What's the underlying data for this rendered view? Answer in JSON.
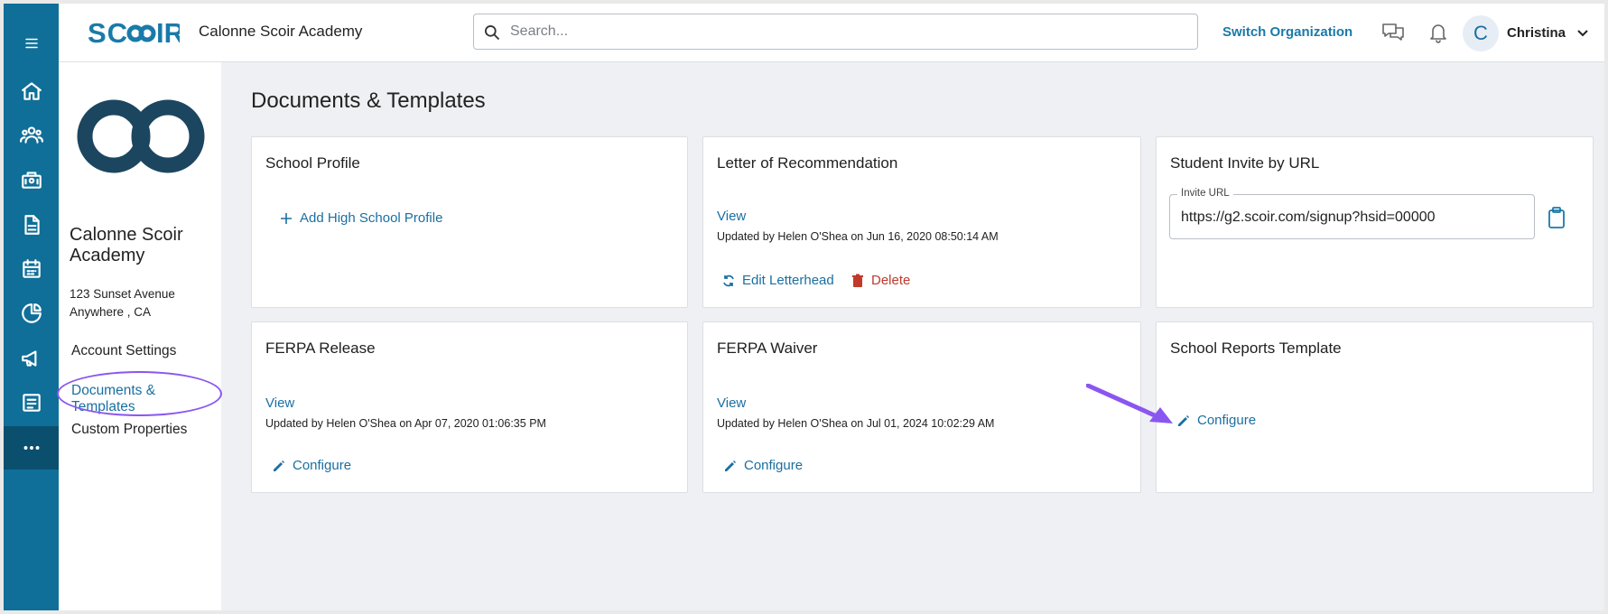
{
  "header": {
    "org_name": "Calonne Scoir Academy",
    "search_placeholder": "Search...",
    "switch_org": "Switch Organization",
    "user_initial": "C",
    "user_name": "Christina"
  },
  "rail": {
    "icons": [
      "menu-icon",
      "home-icon",
      "students-icon",
      "school-icon",
      "document-icon",
      "calendar-icon",
      "analytics-icon",
      "announcement-icon",
      "checklist-icon",
      "more-icon"
    ],
    "accent": "#0f6f98",
    "active_bg": "#0b4f6e"
  },
  "sidebar": {
    "school_name": "Calonne Scoir Academy",
    "address_line1": "123 Sunset Avenue",
    "address_line2": "Anywhere , CA",
    "nav": [
      {
        "label": "Account Settings",
        "active": false
      },
      {
        "label": "Documents & Templates",
        "active": true
      },
      {
        "label": "Custom Properties",
        "active": false
      }
    ]
  },
  "main": {
    "title": "Documents & Templates",
    "cards": {
      "school_profile": {
        "title": "School Profile",
        "add_label": "Add High School Profile"
      },
      "letter": {
        "title": "Letter of Recommendation",
        "view": "View",
        "updated": "Updated by Helen O'Shea on Jun 16, 2020 08:50:14 AM",
        "edit_label": "Edit Letterhead",
        "delete_label": "Delete"
      },
      "invite": {
        "title": "Student Invite by URL",
        "field_label": "Invite URL",
        "url": "https://g2.scoir.com/signup?hsid=00000"
      },
      "ferpa_release": {
        "title": "FERPA Release",
        "view": "View",
        "updated": "Updated by Helen O'Shea on Apr 07, 2020 01:06:35 PM",
        "configure": "Configure"
      },
      "ferpa_waiver": {
        "title": "FERPA Waiver",
        "view": "View",
        "updated": "Updated by Helen O'Shea on Jul 01, 2024 10:02:29 AM",
        "configure": "Configure"
      },
      "school_reports": {
        "title": "School Reports Template",
        "configure": "Configure"
      }
    }
  },
  "colors": {
    "link": "#1a6fa1",
    "danger": "#c0392b",
    "annotation": "#8a56f0"
  }
}
